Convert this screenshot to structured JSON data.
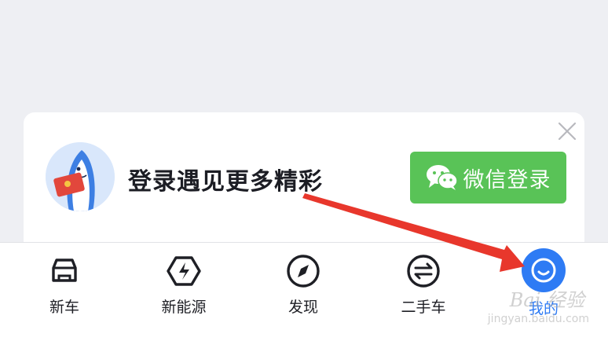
{
  "login_prompt": {
    "text": "登录遇见更多精彩",
    "wechat_button_label": "微信登录"
  },
  "tabbar": {
    "tabs": [
      {
        "label": "新车",
        "icon": "car-icon"
      },
      {
        "label": "新能源",
        "icon": "lightning-hexagon-icon"
      },
      {
        "label": "发现",
        "icon": "compass-icon"
      },
      {
        "label": "二手车",
        "icon": "exchange-arrows-icon"
      },
      {
        "label": "我的",
        "icon": "smiley-face-icon",
        "active": true
      }
    ]
  },
  "watermark": {
    "text": "Bai 经验",
    "sub": "jingyan.baidu.com"
  },
  "colors": {
    "accent": "#2e7bf4",
    "wechat_green": "#59c357",
    "annotation_arrow": "#e8372c"
  }
}
